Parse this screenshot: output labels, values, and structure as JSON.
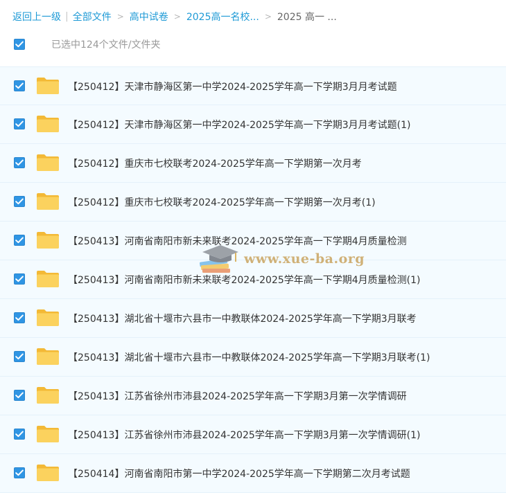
{
  "breadcrumb": {
    "back": "返回上一级",
    "all_files": "全部文件",
    "level1": "高中试卷",
    "level2": "2025高一名校...",
    "current": "2025 高一 ..."
  },
  "selection": {
    "count_text": "已选中124个文件/文件夹",
    "all_checked": true
  },
  "colors": {
    "link": "#1e9ad6",
    "checkbox": "#2f95e4",
    "folder": "#f8c84a",
    "row_bg": "#f4fbff"
  },
  "files": [
    {
      "name": "【250412】天津市静海区第一中学2024-2025学年高一下学期3月月考试题",
      "checked": true,
      "icon": "folder-icon"
    },
    {
      "name": "【250412】天津市静海区第一中学2024-2025学年高一下学期3月月考试题(1)",
      "checked": true,
      "icon": "folder-icon"
    },
    {
      "name": "【250412】重庆市七校联考2024-2025学年高一下学期第一次月考",
      "checked": true,
      "icon": "folder-icon"
    },
    {
      "name": "【250412】重庆市七校联考2024-2025学年高一下学期第一次月考(1)",
      "checked": true,
      "icon": "folder-icon"
    },
    {
      "name": "【250413】河南省南阳市新未来联考2024-2025学年高一下学期4月质量检测",
      "checked": true,
      "icon": "folder-icon"
    },
    {
      "name": "【250413】河南省南阳市新未来联考2024-2025学年高一下学期4月质量检测(1)",
      "checked": true,
      "icon": "folder-icon"
    },
    {
      "name": "【250413】湖北省十堰市六县市一中教联体2024-2025学年高一下学期3月联考",
      "checked": true,
      "icon": "folder-icon"
    },
    {
      "name": "【250413】湖北省十堰市六县市一中教联体2024-2025学年高一下学期3月联考(1)",
      "checked": true,
      "icon": "folder-icon"
    },
    {
      "name": "【250413】江苏省徐州市沛县2024-2025学年高一下学期3月第一次学情调研",
      "checked": true,
      "icon": "folder-icon"
    },
    {
      "name": "【250413】江苏省徐州市沛县2024-2025学年高一下学期3月第一次学情调研(1)",
      "checked": true,
      "icon": "folder-icon"
    },
    {
      "name": "【250414】河南省南阳市第一中学2024-2025学年高一下学期第二次月考试题",
      "checked": true,
      "icon": "folder-icon"
    }
  ],
  "watermark": {
    "text": "www.xue-ba.org"
  }
}
